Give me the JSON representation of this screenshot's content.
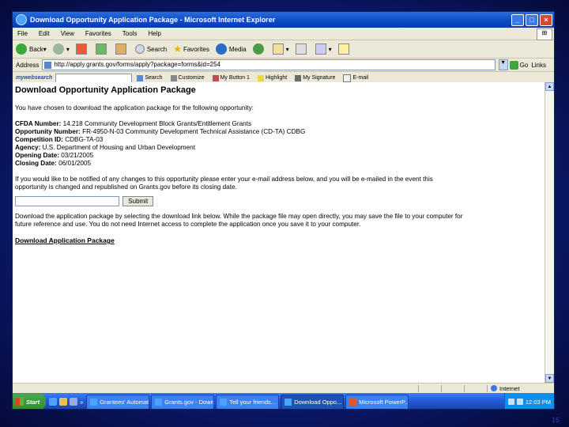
{
  "window": {
    "title": "Download Opportunity Application Package - Microsoft Internet Explorer"
  },
  "menu": [
    "File",
    "Edit",
    "View",
    "Favorites",
    "Tools",
    "Help"
  ],
  "toolbar": {
    "back_label": "Back",
    "search_label": "Search",
    "favorites_label": "Favorites",
    "media_label": "Media"
  },
  "address": {
    "label": "Address",
    "url": "http://apply.grants.gov/forms/apply?package=forms&id=254",
    "go_label": "Go",
    "links_label": "Links"
  },
  "linksbar": {
    "brand": "mywebsearch",
    "items": [
      "Search",
      "Customize",
      "My Button 1",
      "Highlight",
      "My Signature",
      "E-mail"
    ]
  },
  "page": {
    "title": "Download Opportunity Application Package",
    "intro": "You have chosen to download the application package for the following opportunity:",
    "fields": [
      {
        "label": "CFDA Number:",
        "value": "14.218 Community Development Block Grants/Entitlement Grants"
      },
      {
        "label": "Opportunity Number:",
        "value": "FR-4950-N-03 Community Development Technical Assistance (CD-TA) CDBG"
      },
      {
        "label": "Competition ID:",
        "value": "CDBG-TA-03"
      },
      {
        "label": "Agency:",
        "value": "U.S. Department of Housing and Urban Development"
      },
      {
        "label": "Opening Date:",
        "value": "03/21/2005"
      },
      {
        "label": "Closing Date:",
        "value": "06/01/2005"
      }
    ],
    "notify_text_1": "If you would like to be notified of any changes to this opportunity please enter your e-mail address below, and you will be e-mailed in the event this",
    "notify_text_2": "opportunity is changed and republished on Grants.gov before its closing date.",
    "submit_label": "Submit",
    "download_text_1": "Download the application package by selecting the download link below. While the package file may open directly, you may save the file to your computer for",
    "download_text_2": "future reference and use. You do not need Internet access to complete the application once you save it to your computer.",
    "download_link": "Download Application Package"
  },
  "status": {
    "zone": "Internet"
  },
  "taskbar": {
    "start_label": "Start",
    "tasks": [
      "Grantees' Automatic...",
      "Grants.gov - Down...",
      "Tell your friends...",
      "Download Oppo...",
      "Microsoft PowerP..."
    ],
    "clock": "12:03 PM"
  },
  "slide_number": "16"
}
